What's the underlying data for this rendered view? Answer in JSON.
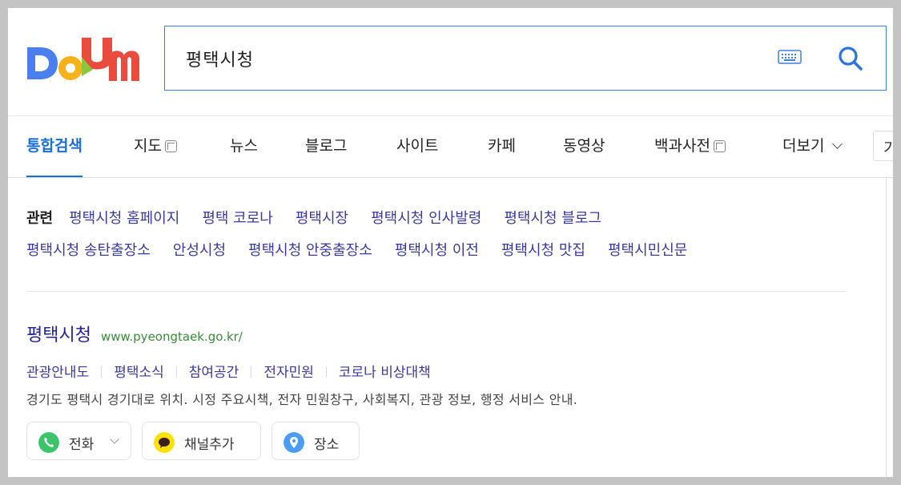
{
  "logo": {
    "text": "Daum"
  },
  "search": {
    "query": "평택시청"
  },
  "tabs": [
    {
      "label": "통합검색",
      "active": true
    },
    {
      "label": "지도",
      "external": true
    },
    {
      "label": "뉴스"
    },
    {
      "label": "블로그"
    },
    {
      "label": "사이트"
    },
    {
      "label": "카페"
    },
    {
      "label": "동영상"
    },
    {
      "label": "백과사전",
      "external": true
    },
    {
      "label": "더보기",
      "dropdown": true
    }
  ],
  "tab_more_partial": "기",
  "related": {
    "label": "관련",
    "links_line1": [
      "평택시청 홈페이지",
      "평택 코로나",
      "평택시장",
      "평택시청 인사발령",
      "평택시청 블로그"
    ],
    "links_line2": [
      "평택시청 송탄출장소",
      "안성시청",
      "평택시청 안중출장소",
      "평택시청 이전",
      "평택시청 맛집",
      "평택시민신문"
    ]
  },
  "result": {
    "title": "평택시청",
    "url": "www.pyeongtaek.go.kr/",
    "sublinks": [
      "관광안내도",
      "평택소식",
      "참여공간",
      "전자민원",
      "코로나 비상대책"
    ],
    "description": "경기도 평택시 경기대로 위치. 시정 주요시책, 전자 민원창구, 사회복지, 관광 정보, 행정 서비스 안내.",
    "actions": [
      {
        "label": "전화",
        "icon": "phone-icon",
        "color": "#3dc46a"
      },
      {
        "label": "채널추가",
        "icon": "kakao-channel-icon",
        "color": "#fae100"
      },
      {
        "label": "장소",
        "icon": "map-pin-icon",
        "color": "#4b9cf5"
      }
    ]
  },
  "colors": {
    "accent": "#1a6fd6",
    "link": "#3a3a9e",
    "url": "#3a8a3a"
  }
}
